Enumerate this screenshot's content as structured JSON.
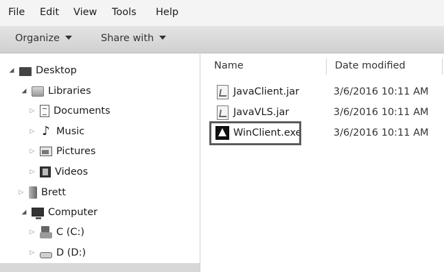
{
  "menu": {
    "items": [
      "File",
      "Edit",
      "View",
      "Tools",
      "Help"
    ]
  },
  "toolbar": {
    "organize_label": "Organize",
    "share_label": "Share with"
  },
  "nav": {
    "desktop": "Desktop",
    "libraries": "Libraries",
    "documents": "Documents",
    "music": "Music",
    "pictures": "Pictures",
    "videos": "Videos",
    "user": "Brett",
    "computer": "Computer",
    "drive_c": "C (C:)",
    "drive_d": "D (D:)"
  },
  "columns": {
    "name": "Name",
    "date_modified": "Date modified"
  },
  "files": [
    {
      "name": "JavaClient.jar",
      "date": "3/6/2016 10:11 AM",
      "icon": "jar-file-icon"
    },
    {
      "name": "JavaVLS.jar",
      "date": "3/6/2016 10:11 AM",
      "icon": "jar-file-icon"
    },
    {
      "name": "WinClient.exe",
      "date": "3/6/2016 10:11 AM",
      "icon": "exe-app-icon"
    }
  ]
}
